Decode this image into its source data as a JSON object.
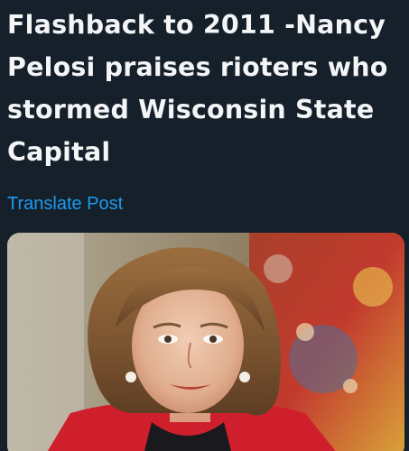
{
  "post": {
    "headline": "Flashback to 2011 -Nancy Pelosi praises rioters who stormed Wisconsin State Capital",
    "translate_label": "Translate Post"
  },
  "media": {
    "kind": "photo",
    "subject": "portrait"
  },
  "colors": {
    "background": "#15202b",
    "text": "#f4f5f6",
    "link": "#1d9bf0",
    "jacket": "#d01f2c"
  }
}
